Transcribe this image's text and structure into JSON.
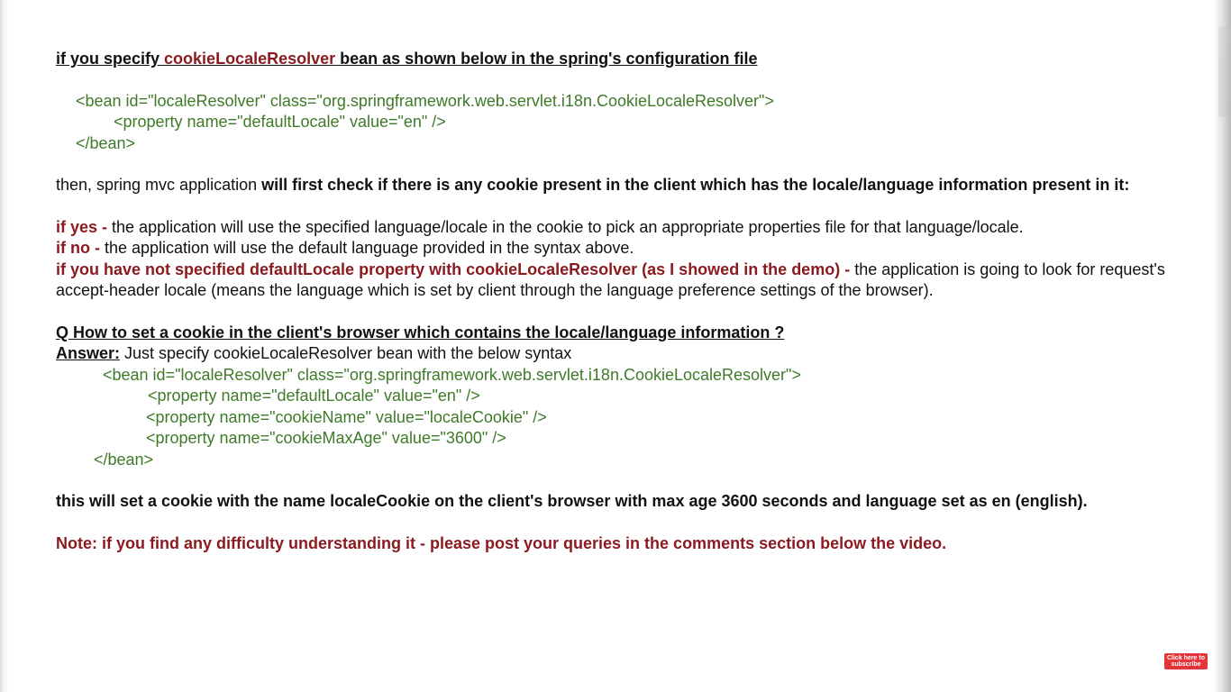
{
  "section1": {
    "heading_pre": "if you specify ",
    "heading_term": "cookieLocaleResolver",
    "heading_post": " bean as shown below in the spring's configuration file",
    "code": [
      "<bean id=\"localeResolver\" class=\"org.springframework.web.servlet.i18n.CookieLocaleResolver\">",
      "<property name=\"defaultLocale\" value=\"en\" />",
      "</bean>"
    ]
  },
  "section2": {
    "intro_plain": "then, spring mvc application ",
    "intro_bold": "will first check if there is any cookie present in the client which has the locale/language information present in it:",
    "yes_label": "if yes - ",
    "yes_text": "the application will use the specified language/locale in the cookie to pick an appropriate properties file for that language/locale.",
    "no_label": "if no - ",
    "no_text": "the application will use the default language provided in the syntax above.",
    "nodefault_label": "if you have not specified defaultLocale property with cookieLocaleResolver (as I showed in the demo) - ",
    "nodefault_text": "the application is going to look for request's accept-header locale (means the language which is set by client through the language preference settings of the browser)."
  },
  "section3": {
    "question": "Q How to set a cookie in the client's browser which contains the locale/language information ?",
    "answer_label": "Answer:",
    "answer_text": " Just specify cookieLocaleResolver bean with the below syntax",
    "code": [
      "<bean id=\"localeResolver\" class=\"org.springframework.web.servlet.i18n.CookieLocaleResolver\">",
      "<property name=\"defaultLocale\" value=\"en\" />",
      "<property name=\"cookieName\" value=\"localeCookie\" />",
      "<property name=\"cookieMaxAge\" value=\"3600\" />",
      "</bean>"
    ],
    "result": "this will set a cookie with the name localeCookie on the client's browser with max age 3600 seconds and language set as en (english)."
  },
  "note": "Note: if you find any difficulty understanding it - please post your queries in the comments section below the video.",
  "subscribe": {
    "line1": "Click here to",
    "line2": "subscribe"
  },
  "colors": {
    "maroon": "#8b1a1f",
    "code_green": "#3f7a2a",
    "subscribe_red": "#e3343a"
  }
}
